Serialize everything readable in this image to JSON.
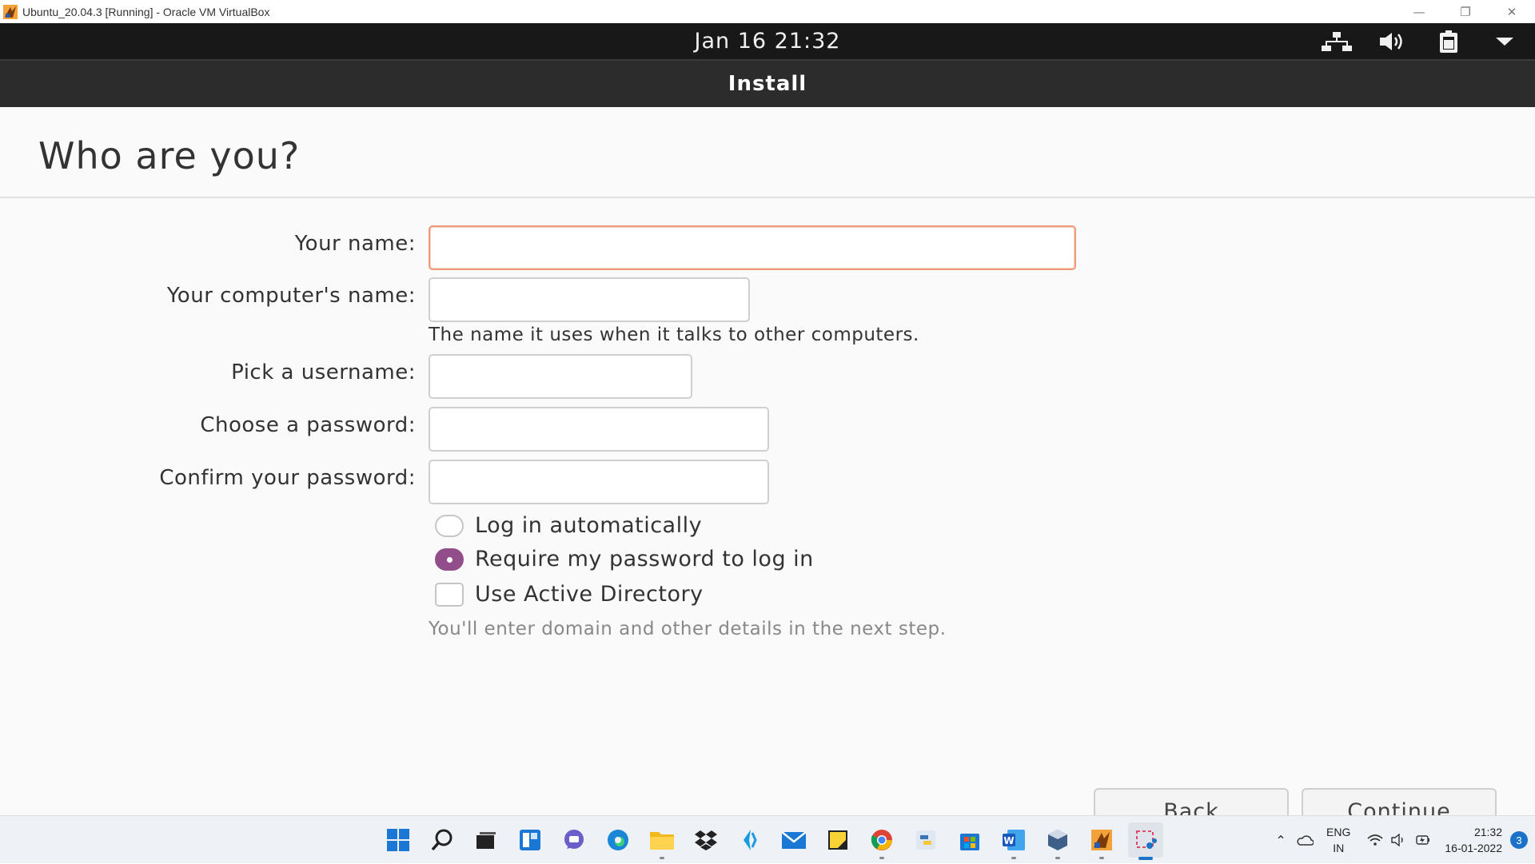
{
  "host_window": {
    "title": "Ubuntu_20.04.3 [Running] - Oracle VM VirtualBox",
    "icon": "virtualbox-icon",
    "controls": [
      "minimize-icon",
      "restore-icon",
      "close-icon"
    ]
  },
  "ubuntu_topbar": {
    "clock": "Jan 16  21:32",
    "tray_icons": [
      "network-icon",
      "volume-icon",
      "battery-icon",
      "menu-arrow-icon"
    ]
  },
  "installer": {
    "header_title": "Install",
    "page_title": "Who are you?",
    "fields": {
      "name": {
        "label": "Your name:",
        "value": ""
      },
      "computer_name": {
        "label": "Your computer's name:",
        "value": "",
        "hint": "The name it uses when it talks to other computers."
      },
      "username": {
        "label": "Pick a username:",
        "value": ""
      },
      "password": {
        "label": "Choose a password:",
        "value": ""
      },
      "confirm_password": {
        "label": "Confirm your password:",
        "value": ""
      }
    },
    "options": {
      "login_auto": {
        "label": "Log in automatically",
        "checked": false
      },
      "require_password": {
        "label": "Require my password to log in",
        "checked": true
      },
      "active_directory": {
        "label": "Use Active Directory",
        "checked": false,
        "hint": "You'll enter domain and other details in the next step."
      }
    },
    "buttons": {
      "back": "Back",
      "continue": "Continue"
    },
    "accent_color": "#924d8b",
    "focus_color": "#f09a7a"
  },
  "taskbar": {
    "apps": [
      "windows-start-icon",
      "search-icon",
      "task-view-icon",
      "widgets-icon",
      "teams-chat-icon",
      "edge-icon",
      "file-explorer-icon",
      "dropbox-icon",
      "vscode-icon",
      "mail-icon",
      "sticky-notes-icon",
      "chrome-icon",
      "python-icon",
      "store-icon",
      "word-icon",
      "virtualbox-icon",
      "virtualbox-vm-icon",
      "snipping-tool-icon"
    ],
    "tray_icons": [
      "chevron-up-icon",
      "onedrive-icon",
      "wifi-icon",
      "speaker-icon",
      "battery-icon"
    ],
    "language": {
      "line1": "ENG",
      "line2": "IN"
    },
    "time": "21:32",
    "date": "16-01-2022",
    "notification_count": "3"
  }
}
